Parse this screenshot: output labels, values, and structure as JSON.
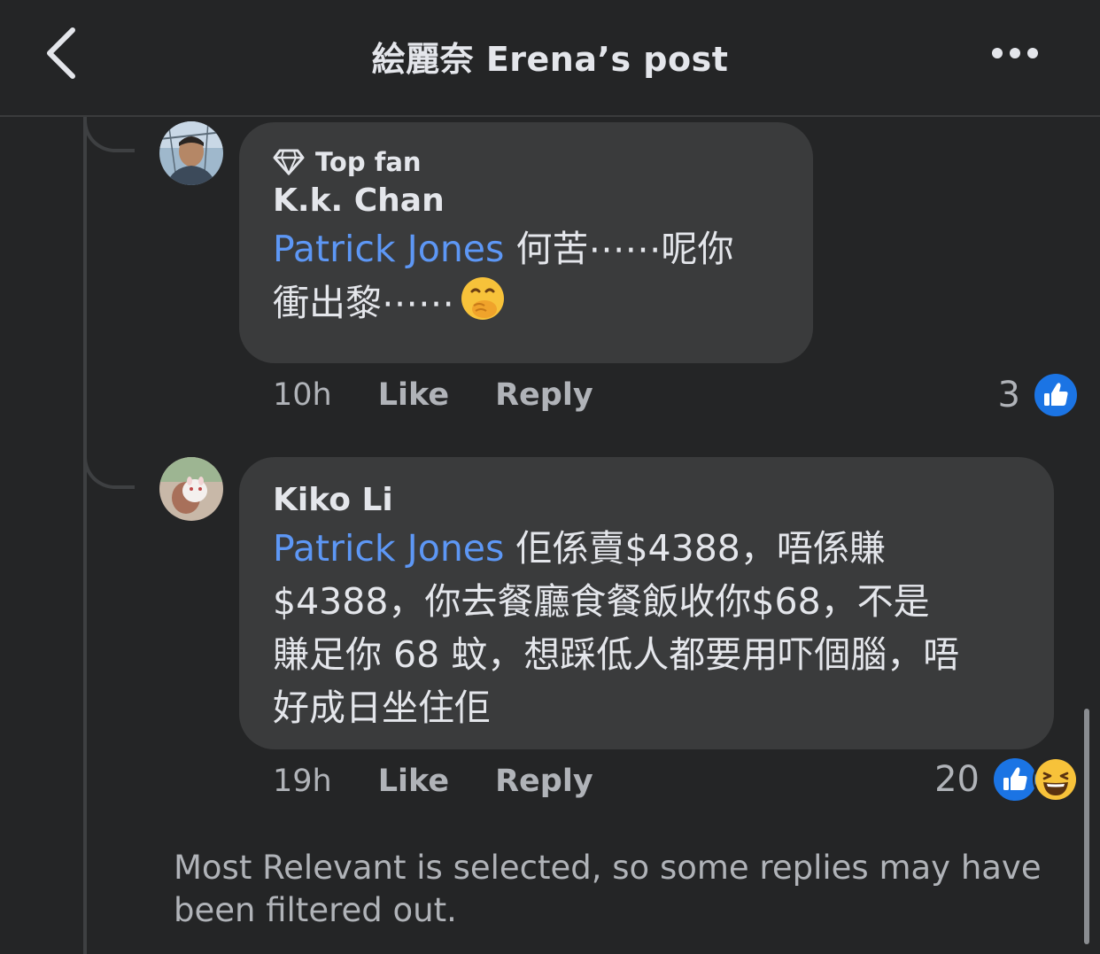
{
  "header": {
    "title": "絵麗奈 Erena’s post"
  },
  "comments": [
    {
      "badge": "Top fan",
      "author": "K.k. Chan",
      "mention": "Patrick Jones",
      "text_line1": " 何苦⋯⋯呢你",
      "text_line2": "衝出黎⋯⋯",
      "time": "10h",
      "like_label": "Like",
      "reply_label": "Reply",
      "reaction_count": "3"
    },
    {
      "author": "Kiko Li",
      "mention": "Patrick Jones",
      "text_line1": " 佢係賣$4388，唔係賺",
      "text_line2": "$4388，你去餐廳食餐飯收你$68，不是",
      "text_line3": "賺足你 68 蚊，想踩低人都要用吓個腦，唔",
      "text_line4": "好成日坐住佢",
      "time": "19h",
      "like_label": "Like",
      "reply_label": "Reply",
      "reaction_count": "20"
    }
  ],
  "filter_note": "Most Relevant is selected, so some replies may have been filtered out.",
  "icons": {
    "back": "chevron-left-icon",
    "more": "more-horizontal-icon",
    "top_fan": "diamond-icon",
    "like_reaction": "thumbs-up-icon",
    "haha_reaction": "laughing-face-icon",
    "emoji": "face-with-hand-over-mouth-icon"
  },
  "colors": {
    "background": "#242526",
    "bubble": "#3a3b3c",
    "mention": "#5d97f5",
    "like_blue": "#1b74e4"
  }
}
